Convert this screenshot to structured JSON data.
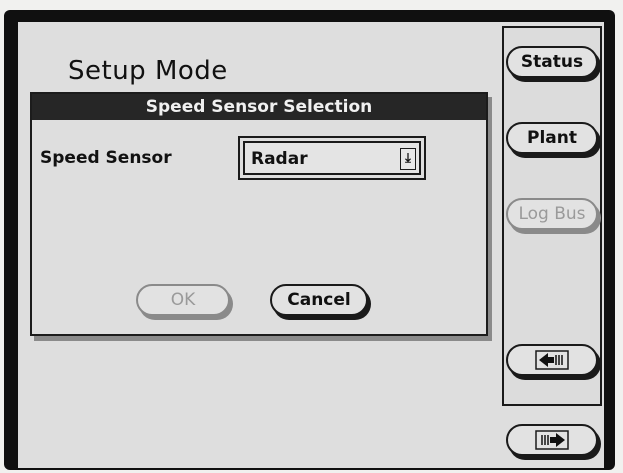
{
  "screen": {
    "mode_title": "Setup Mode"
  },
  "dialog": {
    "title": "Speed Sensor Selection",
    "field_label": "Speed Sensor",
    "select_value": "Radar",
    "ok_label": "OK",
    "cancel_label": "Cancel"
  },
  "side_panel": {
    "status_label": "Status",
    "plant_label": "Plant",
    "logbus_label": "Log Bus",
    "back_icon": "left-arrow-icon",
    "forward_icon": "right-arrow-icon"
  }
}
